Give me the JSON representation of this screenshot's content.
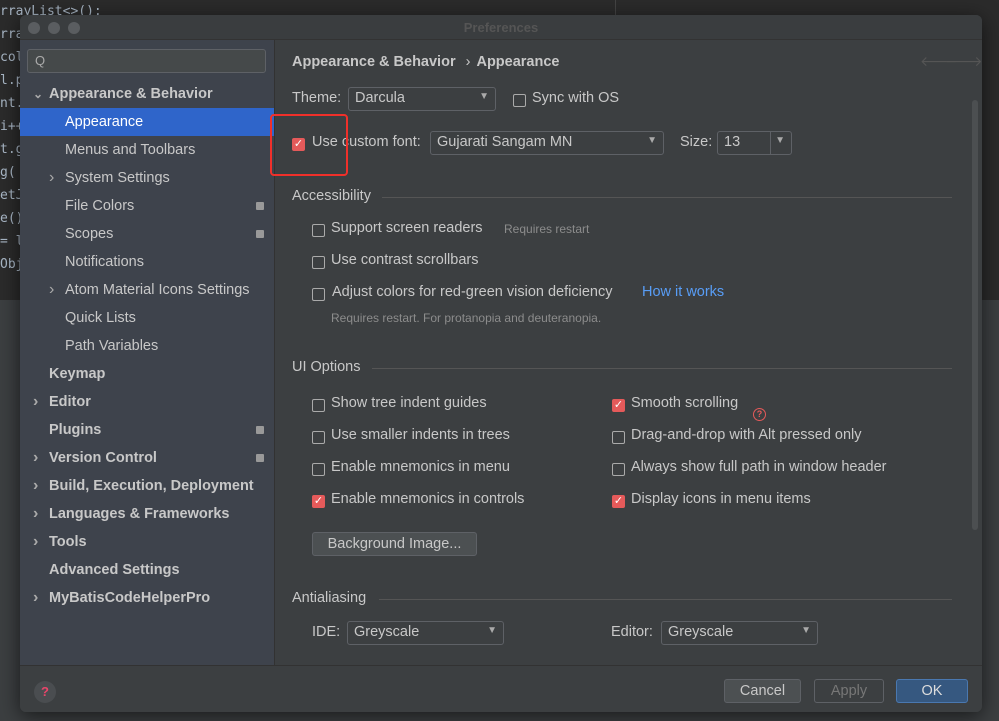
{
  "background_code": [
    "rrayList<>();",
    "rray",
    "col",
    "l.pa",
    "nt.g",
    "i++",
    "t.g",
    "g(",
    "etJS",
    "e();",
    "= li",
    "Obje"
  ],
  "window": {
    "title": "Preferences"
  },
  "sidebar": {
    "search_placeholder": "Q",
    "items": [
      {
        "label": "Appearance & Behavior",
        "expanded": true,
        "bold": true
      },
      {
        "label": "Appearance",
        "selected": true
      },
      {
        "label": "Menus and Toolbars"
      },
      {
        "label": "System Settings",
        "expandable": true
      },
      {
        "label": "File Colors",
        "badge": true
      },
      {
        "label": "Scopes",
        "badge": true
      },
      {
        "label": "Notifications"
      },
      {
        "label": "Atom Material Icons Settings",
        "expandable": true
      },
      {
        "label": "Quick Lists"
      },
      {
        "label": "Path Variables"
      },
      {
        "label": "Keymap",
        "bold": true
      },
      {
        "label": "Editor",
        "bold": true,
        "expandable": true
      },
      {
        "label": "Plugins",
        "bold": true,
        "badge": true
      },
      {
        "label": "Version Control",
        "bold": true,
        "expandable": true,
        "badge": true
      },
      {
        "label": "Build, Execution, Deployment",
        "bold": true,
        "expandable": true
      },
      {
        "label": "Languages & Frameworks",
        "bold": true,
        "expandable": true
      },
      {
        "label": "Tools",
        "bold": true,
        "expandable": true
      },
      {
        "label": "Advanced Settings",
        "bold": true
      },
      {
        "label": "MyBatisCodeHelperPro",
        "bold": true,
        "expandable": true
      }
    ]
  },
  "breadcrumb": {
    "parent": "Appearance & Behavior",
    "sep": "›",
    "current": "Appearance"
  },
  "theme": {
    "label": "Theme:",
    "value": "Darcula",
    "sync_label": "Sync with OS",
    "sync": false
  },
  "font": {
    "label": "Use custom font:",
    "checked": true,
    "value": "Gujarati Sangam MN",
    "size_label": "Size:",
    "size": "13"
  },
  "accessibility": {
    "title": "Accessibility",
    "screen_readers": "Support screen readers",
    "screen_readers_hint": "Requires restart",
    "contrast": "Use contrast scrollbars",
    "red_green": "Adjust colors for red-green vision deficiency",
    "how_link": "How it works",
    "red_green_hint": "Requires restart. For protanopia and deuteranopia."
  },
  "ui_options": {
    "title": "UI Options",
    "left": [
      {
        "label": "Show tree indent guides",
        "checked": false
      },
      {
        "label": "Use smaller indents in trees",
        "checked": false
      },
      {
        "label": "Enable mnemonics in menu",
        "checked": false
      },
      {
        "label": "Enable mnemonics in controls",
        "checked": true
      }
    ],
    "right": [
      {
        "label": "Smooth scrolling",
        "checked": true
      },
      {
        "label": "Drag-and-drop with Alt pressed only",
        "checked": false
      },
      {
        "label": "Always show full path in window header",
        "checked": false
      },
      {
        "label": "Display icons in menu items",
        "checked": true
      }
    ],
    "bg_button": "Background Image..."
  },
  "antialiasing": {
    "title": "Antialiasing",
    "ide_label": "IDE:",
    "ide": "Greyscale",
    "editor_label": "Editor:",
    "editor": "Greyscale"
  },
  "footer": {
    "cancel": "Cancel",
    "apply": "Apply",
    "ok": "OK"
  },
  "colors": {
    "accent": "#2f65ca",
    "checkbox": "#e55a5a",
    "link": "#589df6",
    "highlight": "#f0302a"
  }
}
